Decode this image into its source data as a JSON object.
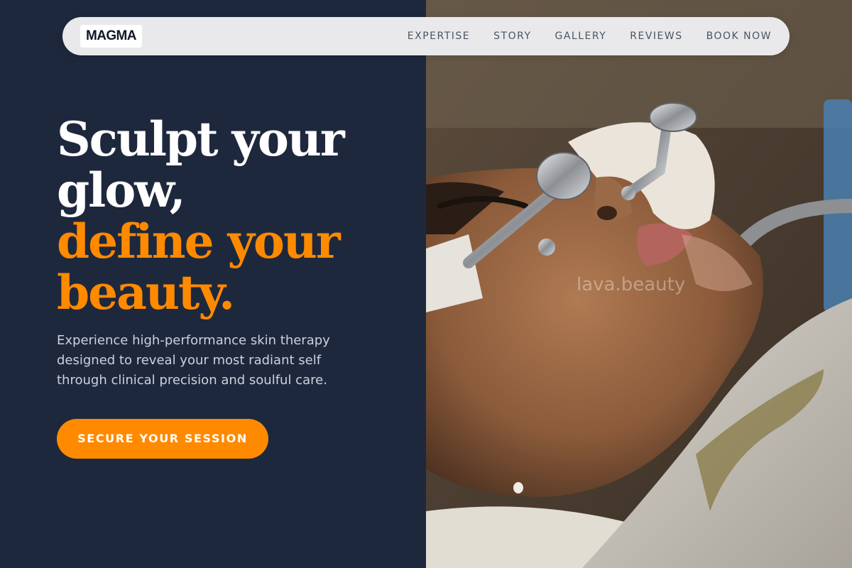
{
  "brand": {
    "logo_text": "MAGMA"
  },
  "nav": {
    "items": [
      {
        "label": "EXPERTISE"
      },
      {
        "label": "STORY"
      },
      {
        "label": "GALLERY"
      },
      {
        "label": "REVIEWS"
      },
      {
        "label": "BOOK NOW"
      }
    ]
  },
  "hero": {
    "headline_line1": "Sculpt your",
    "headline_line2": "glow,",
    "headline_accent_line1": "define your",
    "headline_accent_line2": "beauty.",
    "description": "Experience high-performance skin therapy designed to reveal your most radiant self through clinical precision and soulful care.",
    "cta_label": "SECURE YOUR SESSION"
  },
  "image": {
    "watermark": "lava.beauty",
    "alt": "Facial treatment with metal rollers"
  },
  "colors": {
    "background": "#1e283d",
    "accent": "#ff8a00",
    "nav_background": "#e9e9eb",
    "text_light": "#cbd2de"
  }
}
